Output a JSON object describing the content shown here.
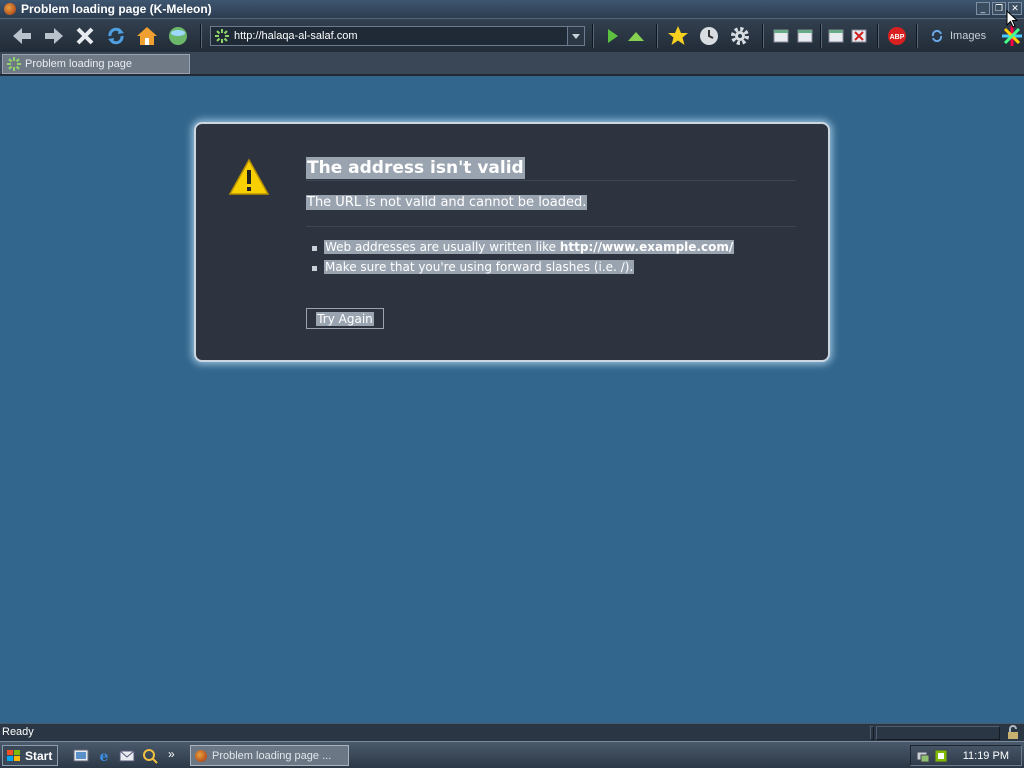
{
  "window": {
    "title": "Problem loading page (K-Meleon)",
    "controls": [
      "minimize",
      "restore",
      "close"
    ]
  },
  "toolbar": {
    "buttons": [
      "back-icon",
      "forward-icon",
      "stop-icon",
      "reload-icon",
      "home-icon",
      "go-globe-icon"
    ],
    "url": "http://halaqa-al-salaf.com",
    "right_buttons": [
      "play-icon",
      "up-icon",
      "bookmark-star-icon",
      "history-clock-icon",
      "settings-gear-icon",
      "window-icon",
      "window-icon",
      "window-icon",
      "close-window-icon",
      "adblock-icon"
    ],
    "images_label": "Images"
  },
  "tab": {
    "label": "Problem loading page"
  },
  "error": {
    "title": "The address isn't valid",
    "short_desc": "The URL is not valid and cannot be loaded.",
    "bullets": [
      {
        "prefix": "Web addresses are usually written like ",
        "bold": "http://www.example.com/"
      },
      {
        "prefix": "Make sure that you're using forward slashes (i.e. /).",
        "bold": ""
      }
    ],
    "try_again": "Try Again"
  },
  "statusbar": {
    "text": "Ready"
  },
  "taskbar": {
    "start": "Start",
    "quick_launch": [
      "desktop-icon",
      "ie-icon",
      "outlook-icon",
      "explorer-icon"
    ],
    "more": "»",
    "task_label": "Problem loading page ...",
    "clock": "11:19 PM"
  },
  "colors": {
    "page_bg": "#33668c",
    "box_bg": "#2d3440",
    "highlight": "#9aa4b0"
  }
}
